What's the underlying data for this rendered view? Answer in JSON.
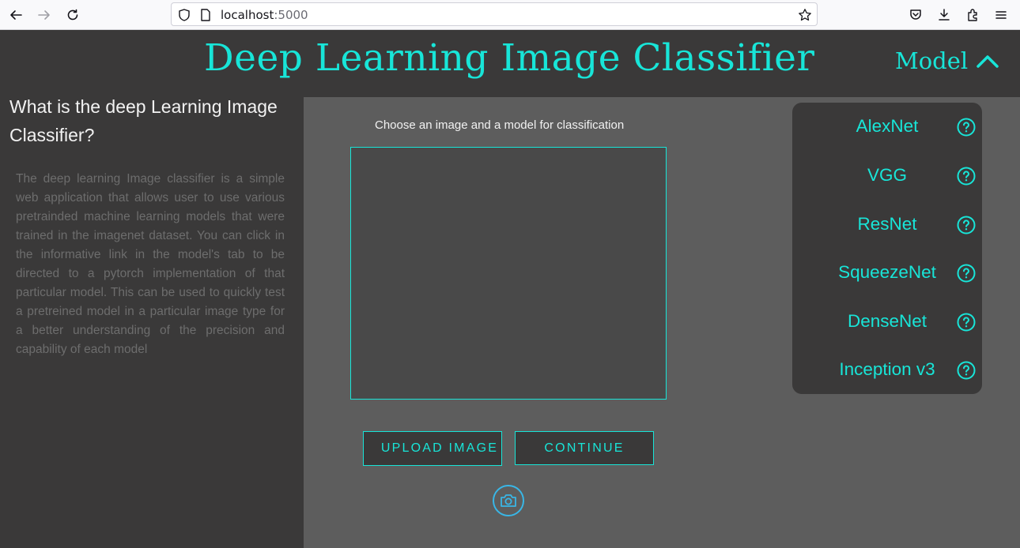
{
  "browser": {
    "url_host": "localhost",
    "url_port": ":5000"
  },
  "header": {
    "title": "Deep Learning Image Classifier",
    "model_toggle_label": "Model"
  },
  "sidebar": {
    "heading": "What is the deep Learning Image Classifier?",
    "description": "The deep learning Image classifier is a simple web application that allows user to use various pretrainded machine learning models that were trained in the imagenet dataset. You can click in the informative link in the model's tab to be directed to a pytorch implementation of that particular model. This can be used to quickly test a pretreined model in a particular image type for a better understanding of the precision and capability of each model"
  },
  "main": {
    "instruction": "Choose an image and a model for classification",
    "upload_label": "UPLOAD IMAGE",
    "continue_label": "CONTINUE"
  },
  "models": {
    "items": [
      {
        "label": "AlexNet"
      },
      {
        "label": "VGG"
      },
      {
        "label": "ResNet"
      },
      {
        "label": "SqueezeNet"
      },
      {
        "label": "DenseNet"
      },
      {
        "label": "Inception v3"
      }
    ]
  },
  "colors": {
    "accent": "#18e5d8",
    "background_dark": "#3a3939",
    "background_main": "#5d5d5d",
    "camera_ring": "#39b6e6"
  }
}
